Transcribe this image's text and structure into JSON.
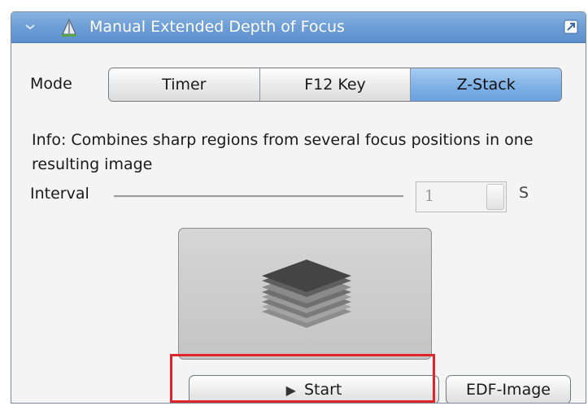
{
  "panel": {
    "title": "Manual Extended Depth of Focus"
  },
  "mode": {
    "label": "Mode",
    "options": [
      "Timer",
      "F12 Key",
      "Z-Stack"
    ],
    "selected": "Z-Stack"
  },
  "info": {
    "text": "Info: Combines sharp regions from several focus positions in one resulting image"
  },
  "interval": {
    "label": "Interval",
    "value": "1",
    "unit": "S"
  },
  "actions": {
    "start_label": "Start",
    "edf_label": "EDF-Image"
  },
  "icons": {
    "collapse": "collapse-icon",
    "app": "edf-app-icon",
    "popout": "popout-icon",
    "preview": "z-stack-layers-icon",
    "play": "play-icon"
  },
  "colors": {
    "titlebar": "#6f9fd6",
    "active_segment": "#7fb1e6",
    "highlight": "#e0242b"
  }
}
